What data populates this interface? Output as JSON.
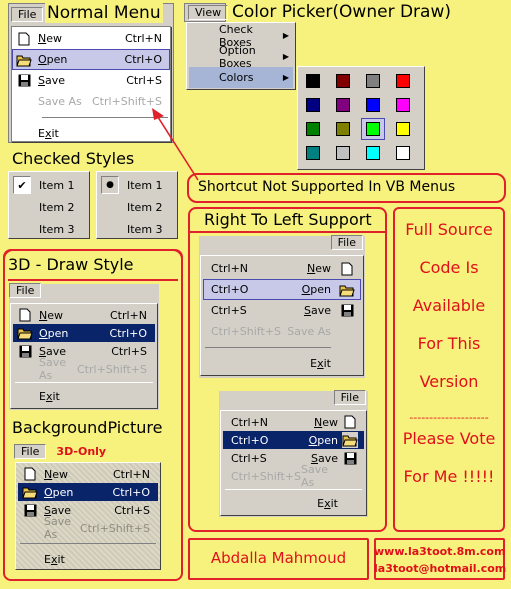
{
  "normal_menu": {
    "title": "Normal Menu",
    "file": "File",
    "items": [
      {
        "label": "New",
        "u": "N",
        "shortcut": "Ctrl+N",
        "icon": "new-file-icon"
      },
      {
        "label": "Open",
        "u": "O",
        "shortcut": "Ctrl+O",
        "icon": "open-folder-icon"
      },
      {
        "label": "Save",
        "u": "S",
        "shortcut": "Ctrl+S",
        "icon": "save-disk-icon"
      },
      {
        "label": "Save As",
        "shortcut": "Ctrl+Shift+S"
      },
      {
        "label": "Exit",
        "u": "x"
      }
    ]
  },
  "color_picker": {
    "title": "Color Picker(Owner Draw)",
    "view": "View",
    "items": [
      "Check Boxes",
      "Option Boxes",
      "Colors"
    ],
    "colors": [
      "#000000",
      "#800000",
      "#808080",
      "#ff0000",
      "#000080",
      "#800080",
      "#0000ff",
      "#ff00ff",
      "#008000",
      "#808000",
      "#00ff00",
      "#ffff00",
      "#008080",
      "#c0c0c0",
      "#00ffff",
      "#ffffff"
    ]
  },
  "shortcut_note": "Shortcut Not Supported In VB Menus",
  "checked": {
    "title": "Checked Styles",
    "items": [
      "Item 1",
      "Item 2",
      "Item 3"
    ]
  },
  "rtl": {
    "title": "Right To Left Support",
    "file": "File"
  },
  "draw3d": {
    "title": "3D - Draw Style",
    "file": "File"
  },
  "bgpic": {
    "title": "BackgroundPicture",
    "badge": "3D-Only",
    "file": "File"
  },
  "full_source": {
    "lines": [
      "Full Source",
      "Code Is",
      "Available",
      "For This",
      "Version"
    ],
    "dashes": "--------------------",
    "vote": [
      "Please Vote",
      "For Me !!!!!"
    ]
  },
  "author": "Abdalla Mahmoud",
  "contact": {
    "web": "www.la3toot.8m.com",
    "email": "la3toot@hotmail.com"
  },
  "menu_items": {
    "new": "New",
    "open": "Open",
    "save": "Save",
    "save_as": "Save As",
    "exit": "Exit",
    "ctrl_n": "Ctrl+N",
    "ctrl_o": "Ctrl+O",
    "ctrl_s": "Ctrl+S",
    "ctrl_shift_s": "Ctrl+Shift+S"
  }
}
